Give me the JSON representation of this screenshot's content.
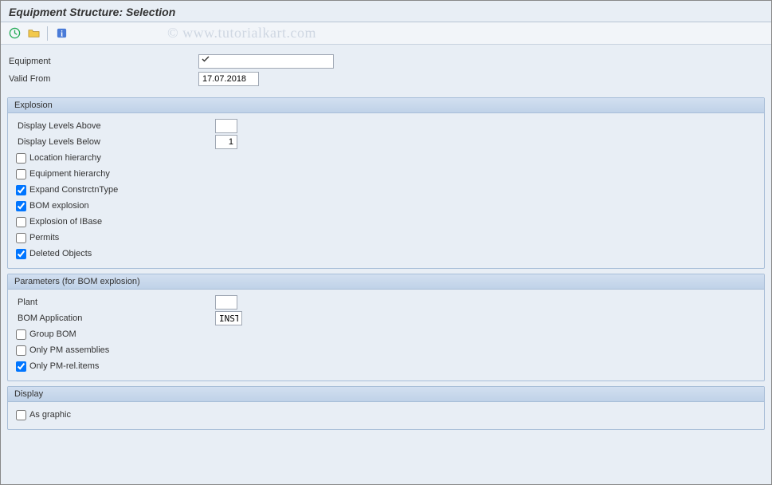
{
  "title": "Equipment Structure: Selection",
  "watermark": "© www.tutorialkart.com",
  "fields": {
    "equipment": {
      "label": "Equipment",
      "value": ""
    },
    "valid_from": {
      "label": "Valid From",
      "value": "17.07.2018"
    }
  },
  "explosion": {
    "title": "Explosion",
    "levels_above": {
      "label": "Display Levels Above",
      "value": ""
    },
    "levels_below": {
      "label": "Display Levels Below",
      "value": "1"
    },
    "location_hierarchy": {
      "label": "Location hierarchy",
      "checked": false
    },
    "equipment_hierarchy": {
      "label": "Equipment hierarchy",
      "checked": false
    },
    "expand_constrctn": {
      "label": "Expand ConstrctnType",
      "checked": true
    },
    "bom_explosion": {
      "label": "BOM explosion",
      "checked": true
    },
    "explosion_ibase": {
      "label": "Explosion of IBase",
      "checked": false
    },
    "permits": {
      "label": "Permits",
      "checked": false
    },
    "deleted_objects": {
      "label": "Deleted Objects",
      "checked": true
    }
  },
  "parameters": {
    "title": "Parameters (for BOM explosion)",
    "plant": {
      "label": "Plant",
      "value": ""
    },
    "bom_application": {
      "label": "BOM Application",
      "value": "INST"
    },
    "group_bom": {
      "label": "Group BOM",
      "checked": false
    },
    "only_pm_assemblies": {
      "label": "Only PM assemblies",
      "checked": false
    },
    "only_pm_rel_items": {
      "label": "Only PM-rel.items",
      "checked": true
    }
  },
  "display": {
    "title": "Display",
    "as_graphic": {
      "label": "As graphic",
      "checked": false
    }
  }
}
